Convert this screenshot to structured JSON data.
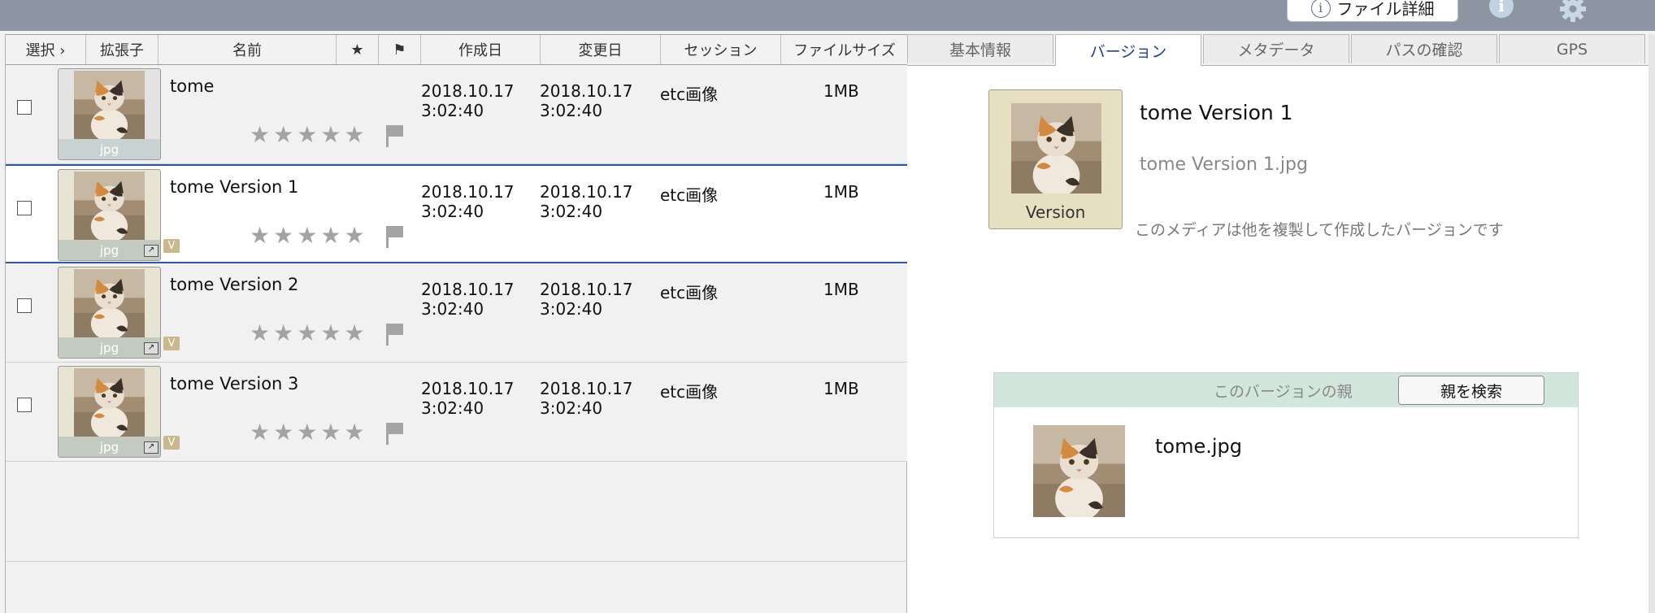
{
  "toolbar": {
    "file_detail_label": "ファイル詳細",
    "info_icon_glyph": "i"
  },
  "list": {
    "headers": {
      "select": "選択 ›",
      "ext": "拡張子",
      "name": "名前",
      "star": "★",
      "flag": "⚑",
      "created": "作成日",
      "modified": "変更日",
      "session": "セッション",
      "filesize": "ファイルサイズ"
    },
    "rows": [
      {
        "ext": "jpg",
        "name": "tome",
        "created_date": "2018.10.17",
        "created_time": "3:02:40",
        "modified_date": "2018.10.17",
        "modified_time": "3:02:40",
        "session": "etc画像",
        "size": "1MB",
        "version_badge": ""
      },
      {
        "ext": "jpg",
        "name": "tome Version 1",
        "created_date": "2018.10.17",
        "created_time": "3:02:40",
        "modified_date": "2018.10.17",
        "modified_time": "3:02:40",
        "session": "etc画像",
        "size": "1MB",
        "version_badge": "V"
      },
      {
        "ext": "jpg",
        "name": "tome Version 2",
        "created_date": "2018.10.17",
        "created_time": "3:02:40",
        "modified_date": "2018.10.17",
        "modified_time": "3:02:40",
        "session": "etc画像",
        "size": "1MB",
        "version_badge": "V"
      },
      {
        "ext": "jpg",
        "name": "tome Version 3",
        "created_date": "2018.10.17",
        "created_time": "3:02:40",
        "modified_date": "2018.10.17",
        "modified_time": "3:02:40",
        "session": "etc画像",
        "size": "1MB",
        "version_badge": "V"
      }
    ],
    "star_glyph": "★",
    "rating": 0,
    "selected_row": 1
  },
  "detail": {
    "tabs": [
      "基本情報",
      "バージョン",
      "メタデータ",
      "パスの確認",
      "GPS"
    ],
    "active_tab": 1,
    "version_thumb_label": "Version",
    "version_title": "tome Version 1",
    "version_filename": "tome Version 1.jpg",
    "version_description": "このメディアは他を複製して作成したバージョンです",
    "parent_section_label": "このバージョンの親",
    "parent_search_button": "親を検索",
    "parent_name": "tome.jpg"
  },
  "colors": {
    "toolbar_bg": "#8c95a1",
    "selected_border": "#2b5aa8",
    "active_tab_text": "#1f3f8f",
    "parent_header_bg": "#d3e6dd",
    "version_thumb_bg": "#e6dfc2"
  }
}
